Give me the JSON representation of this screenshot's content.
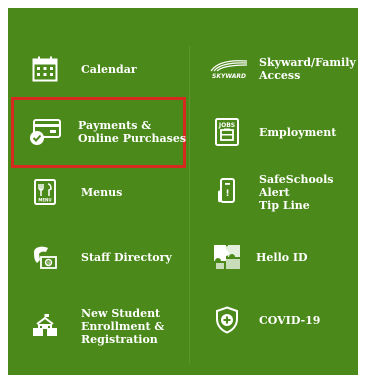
{
  "colors": {
    "panel_background": "#4b8a1a",
    "text": "#ffffff",
    "selection_border": "#d62a20"
  },
  "left_links": [
    {
      "icon": "calendar-icon",
      "label": "Calendar"
    },
    {
      "icon": "payment-card-icon",
      "label": "Payments &\nOnline Purchases"
    },
    {
      "icon": "menu-book-icon",
      "label": "Menus"
    },
    {
      "icon": "contact-directory-icon",
      "label": "Staff Directory"
    },
    {
      "icon": "school-building-icon",
      "label": "New Student\nEnrollment &\nRegistration"
    }
  ],
  "right_links": [
    {
      "icon": "skyward-logo-icon",
      "label": "Skyward/Family\nAccess"
    },
    {
      "icon": "jobs-icon",
      "label": "Employment"
    },
    {
      "icon": "phone-alert-icon",
      "label": "SafeSchools Alert\nTip Line"
    },
    {
      "icon": "puzzle-icon",
      "label": "Hello ID"
    },
    {
      "icon": "shield-plus-icon",
      "label": "COVID-19"
    }
  ],
  "skyward_logo_text": "SKYWARD"
}
